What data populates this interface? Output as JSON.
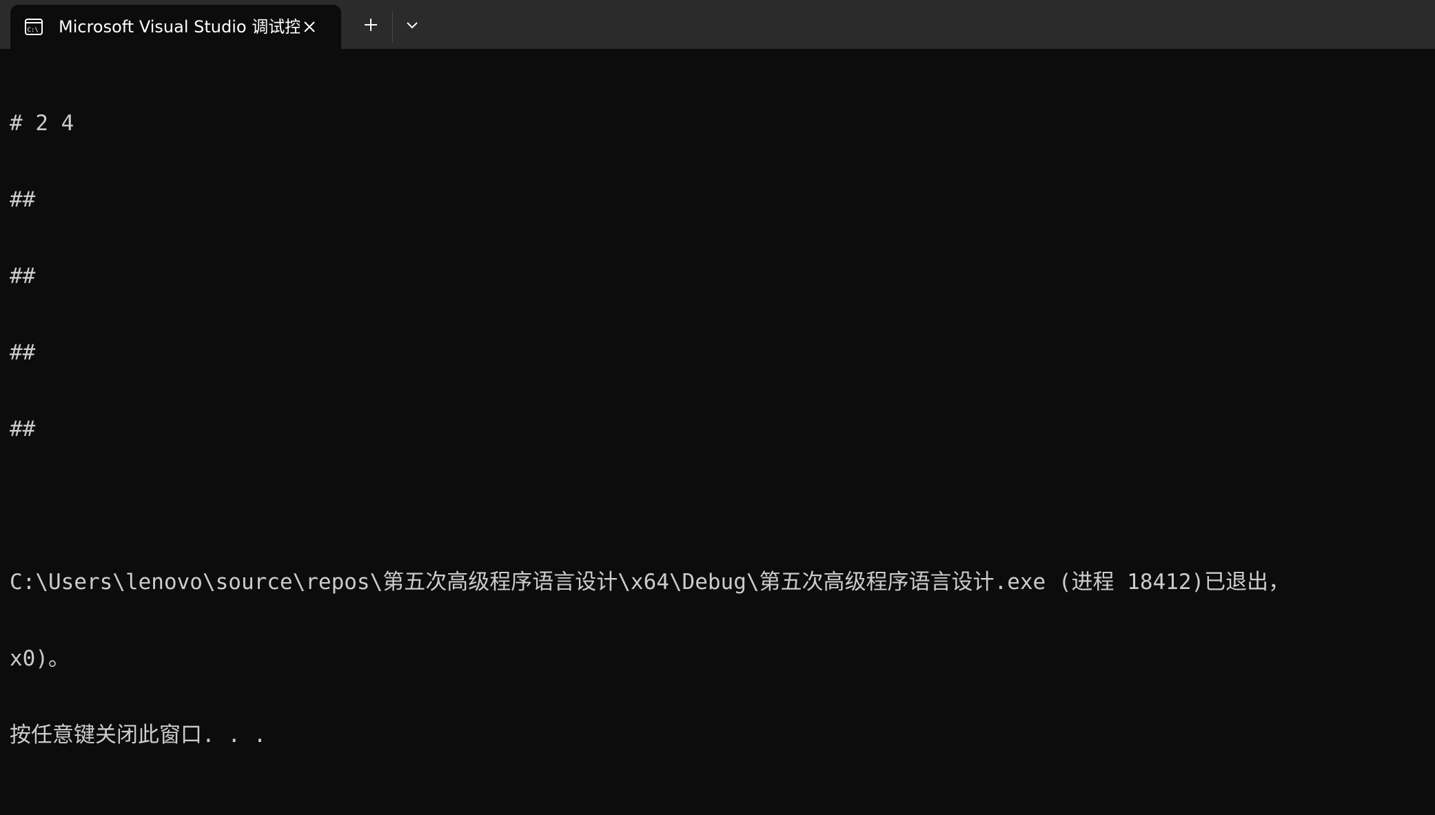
{
  "window": {
    "tab_title": "Microsoft Visual Studio 调试控",
    "tab_icon": "console-icon",
    "close_icon": "close-icon",
    "new_tab_icon": "plus-icon",
    "dropdown_icon": "chevron-down-icon"
  },
  "console": {
    "lines": [
      "# 2 4",
      "##",
      "##",
      "##",
      "##",
      "",
      "C:\\Users\\lenovo\\source\\repos\\第五次高级程序语言设计\\x64\\Debug\\第五次高级程序语言设计.exe (进程 18412)已退出，",
      "x0)。",
      "按任意键关闭此窗口. . ."
    ]
  },
  "colors": {
    "titlebar_bg": "#2b2b2b",
    "console_bg": "#0c0c0c",
    "console_text": "#cccccc",
    "tab_text": "#ffffff"
  }
}
